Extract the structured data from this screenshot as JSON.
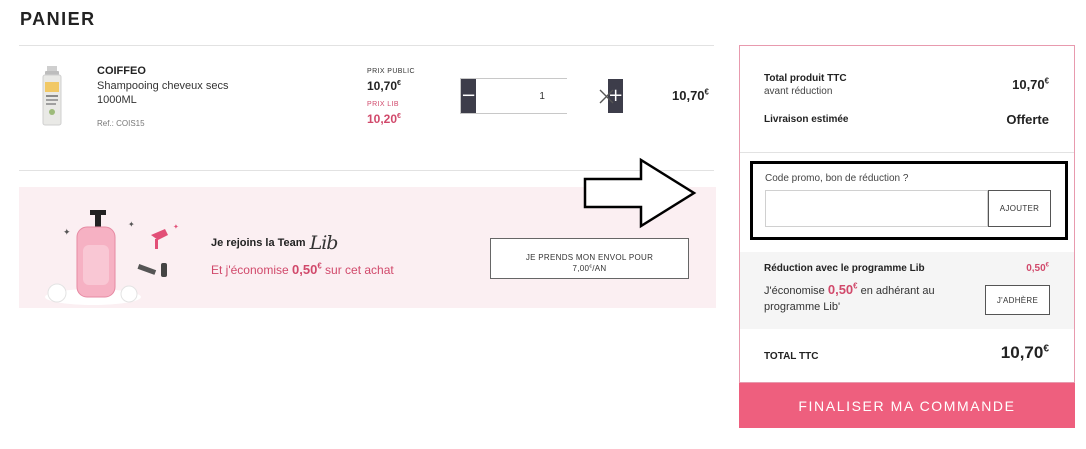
{
  "page": {
    "title": "PANIER"
  },
  "product": {
    "brand": "COIFFEO",
    "name": "Shampooing cheveux secs 1000ML",
    "ref": "Ref.: COIS15",
    "public_price_label": "PRIX PUBLIC",
    "public_price": "10,70",
    "lib_price_label": "PRIX LIB",
    "lib_price": "10,20",
    "currency": "€",
    "quantity": "1",
    "line_total": "10,70",
    "minus": "−",
    "plus": "+"
  },
  "banner": {
    "join_text": "Je rejoins la Team",
    "lib_logo": "Lib",
    "save_prefix": "Et j'économise",
    "save_amount": "0,50",
    "save_suffix": "sur cet achat",
    "button_line1": "JE PRENDS MON ENVOL POUR",
    "button_price": "7,00",
    "button_unit": "/AN"
  },
  "summary": {
    "total_product_label": "Total produit TTC",
    "total_product_sub": "avant réduction",
    "total_product_value": "10,70",
    "shipping_label": "Livraison estimée",
    "shipping_value": "Offerte",
    "promo_label": "Code promo, bon de réduction ?",
    "promo_value": "",
    "promo_button": "AJOUTER",
    "lib_title": "Réduction avec le programme Lib",
    "lib_amount": "0,50",
    "lib_desc_prefix": "J'économise",
    "lib_desc_amount": "0,50",
    "lib_desc_suffix": "en adhérant au programme Lib'",
    "lib_button": "J'ADHÈRE",
    "total_label": "TOTAL TTC",
    "total_value": "10,70",
    "currency": "€"
  },
  "checkout": {
    "label": "FINALISER MA COMMANDE"
  },
  "colors": {
    "accent": "#ee5f7e",
    "pink_text": "#d1496b",
    "dark": "#3d3d4a",
    "banner_bg": "#fbeff2",
    "panel_border": "#e89aae"
  }
}
